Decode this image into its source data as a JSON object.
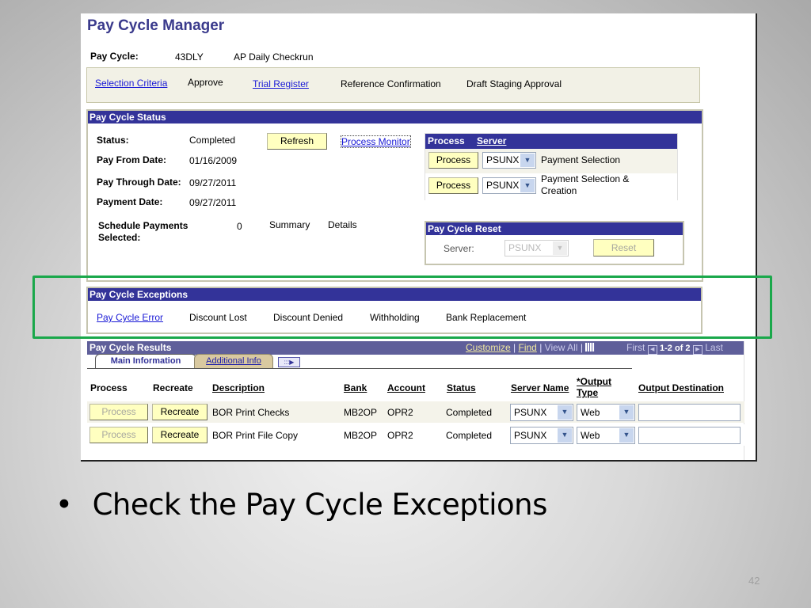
{
  "page": {
    "title": "Pay Cycle Manager",
    "pay_cycle_label": "Pay Cycle:",
    "pay_cycle_id": "43DLY",
    "pay_cycle_desc": "AP Daily Checkrun"
  },
  "nav": {
    "items": [
      {
        "label": "Selection Criteria",
        "link": true
      },
      {
        "label": "Approve",
        "link": false
      },
      {
        "label": "Trial Register",
        "link": true
      },
      {
        "label": "Reference Confirmation",
        "link": false
      },
      {
        "label": "Draft Staging Approval",
        "link": false
      }
    ]
  },
  "status": {
    "header": "Pay Cycle Status",
    "fields": [
      {
        "label": "Status:",
        "value": "Completed"
      },
      {
        "label": "Pay From Date:",
        "value": "01/16/2009"
      },
      {
        "label": "Pay Through Date:",
        "value": "09/27/2011"
      },
      {
        "label": "Payment Date:",
        "value": "09/27/2011"
      }
    ],
    "schedule_label_1": "Schedule Payments",
    "schedule_label_2": "Selected:",
    "schedule_value": "0",
    "summary_label": "Summary",
    "details_label": "Details",
    "refresh_label": "Refresh",
    "process_monitor_label": "Process Monitor"
  },
  "process": {
    "col_process": "Process",
    "col_server": "Server",
    "rows": [
      {
        "button": "Process",
        "server": "PSUNX",
        "desc_1": "Payment Selection",
        "desc_2": ""
      },
      {
        "button": "Process",
        "server": "PSUNX",
        "desc_1": "Payment Selection &",
        "desc_2": "Creation"
      }
    ]
  },
  "reset": {
    "header": "Pay Cycle Reset",
    "server_label": "Server:",
    "server_value": "PSUNX",
    "reset_label": "Reset"
  },
  "exceptions": {
    "header": "Pay Cycle Exceptions",
    "items": [
      {
        "label": "Pay Cycle Error",
        "link": true
      },
      {
        "label": "Discount Lost",
        "link": false
      },
      {
        "label": "Discount Denied",
        "link": false
      },
      {
        "label": "Withholding",
        "link": false
      },
      {
        "label": "Bank Replacement",
        "link": false
      }
    ]
  },
  "results": {
    "header": "Pay Cycle Results",
    "customize": "Customize",
    "find": "Find",
    "view_all": "View All",
    "first": "First",
    "range": "1-2 of 2",
    "last": "Last",
    "tabs": {
      "main": "Main Information",
      "additional": "Additional Info"
    },
    "columns": {
      "process": "Process",
      "recreate": "Recreate",
      "description": "Description",
      "bank": "Bank",
      "account": "Account",
      "status": "Status",
      "server_name": "Server Name",
      "output_type_1": "*Output",
      "output_type_2": "Type",
      "output_destination": "Output Destination"
    },
    "rows": [
      {
        "process": "Process",
        "recreate": "Recreate",
        "description": "BOR Print Checks",
        "bank": "MB2OP",
        "account": "OPR2",
        "status": "Completed",
        "server": "PSUNX",
        "output_type": "Web",
        "destination": ""
      },
      {
        "process": "Process",
        "recreate": "Recreate",
        "description": "BOR Print File Copy",
        "bank": "MB2OP",
        "account": "OPR2",
        "status": "Completed",
        "server": "PSUNX",
        "output_type": "Web",
        "destination": ""
      }
    ]
  },
  "slide": {
    "bullet": "Check the Pay Cycle Exceptions",
    "page_number": "42",
    "highlight_color": "#1aa84b"
  }
}
